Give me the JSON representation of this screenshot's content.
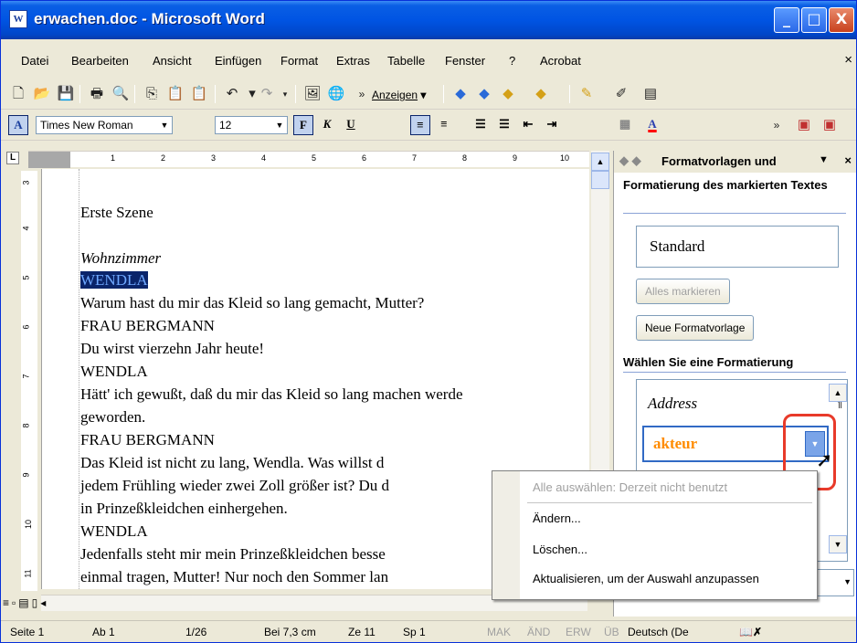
{
  "window": {
    "title": "erwachen.doc - Microsoft Word",
    "app_icon": "W",
    "buttons": [
      "_",
      "□",
      "X"
    ]
  },
  "menu": {
    "items": [
      "Datei",
      "Bearbeiten",
      "Ansicht",
      "Einfügen",
      "Format",
      "Extras",
      "Tabelle",
      "Fenster",
      "?",
      "Acrobat"
    ],
    "close": "×"
  },
  "toolbar": {
    "show_label": "Anzeigen",
    "show_arrow": "▾",
    "overflow": "»"
  },
  "format": {
    "style_icon": "A",
    "font": "Times New Roman",
    "size": "12",
    "bold": "F",
    "italic": "K",
    "underline": "U",
    "font_color": "A"
  },
  "ruler": {
    "corner": "L",
    "numbers": [
      "1",
      "2",
      "3",
      "4",
      "5",
      "6",
      "7",
      "8",
      "9",
      "10"
    ],
    "vertical_numbers": [
      "3",
      "4",
      "5",
      "6",
      "7",
      "8",
      "9",
      "10",
      "11"
    ]
  },
  "document": {
    "lines": [
      "Erste Szene",
      "Wohnzimmer",
      "WENDLA",
      "Warum hast du mir das Kleid so lang gemacht, Mutter?",
      "FRAU BERGMANN",
      "Du wirst vierzehn Jahr heute!",
      "WENDLA",
      "Hätt' ich gewußt, daß du mir das Kleid so lang machen werde",
      "geworden.",
      "FRAU BERGMANN",
      "Das Kleid ist nicht zu lang, Wendla. Was willst d",
      "jedem Frühling wieder zwei Zoll größer ist? Du d",
      "in Prinzeßkleidchen einhergehen.",
      "WENDLA",
      "Jedenfalls steht mir mein Prinzeßkleidchen besse",
      "einmal tragen, Mutter! Nur noch den Sommer lan"
    ]
  },
  "taskpane": {
    "title": "Formatvorlagen und",
    "nav_back": "◆",
    "nav_fwd": "◆",
    "dropdown": "▼",
    "close": "×",
    "section1": "Formatierung des markierten Textes",
    "current_style": "Standard",
    "select_all_button": "Alles markieren",
    "new_style_button": "Neue Formatvorlage",
    "section2": "Wählen Sie eine Formatierung",
    "list_items": [
      "Address",
      "akteur"
    ],
    "para_mark": "¶"
  },
  "context_menu": {
    "items": [
      "Alle auswählen: Derzeit nicht benutzt",
      "Ändern...",
      "Löschen...",
      "Aktualisieren, um der Auswahl anzupassen"
    ]
  },
  "statusbar": {
    "page": "Seite 1",
    "section": "Ab 1",
    "pages": "1/26",
    "position": "Bei 7,3 cm",
    "line": "Ze 11",
    "column": "Sp 1",
    "mak": "MAK",
    "aend": "ÄND",
    "erw": "ERW",
    "ueb": "ÜB",
    "language": "Deutsch (De"
  },
  "colors": {
    "titlebar": "#0054e3",
    "selection": "#0a246a",
    "style_akteur": "#ff8c00",
    "highlight_box": "#e83a2a"
  }
}
